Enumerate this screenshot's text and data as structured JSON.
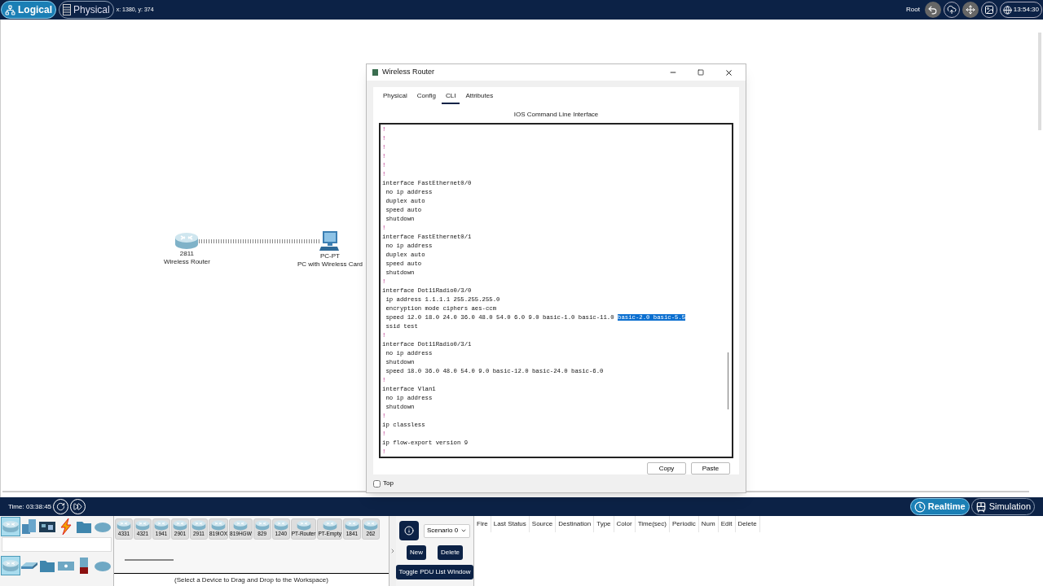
{
  "top_bar": {
    "modes": [
      {
        "label": "Logical",
        "kind": "logical",
        "selected": true
      },
      {
        "label": "Physical",
        "kind": "physical",
        "selected": false
      }
    ],
    "coords": "x: 1380, y: 374",
    "user": "Root",
    "clock": "13:54:30"
  },
  "workspace": {
    "nodes": [
      {
        "kind": "router",
        "model": "2811",
        "name": "Wireless Router"
      },
      {
        "kind": "pc",
        "model": "PC-PT",
        "name": "PC with Wireless Card"
      }
    ]
  },
  "dialog": {
    "title": "Wireless Router",
    "tabs": [
      {
        "label": "Physical",
        "selected": false
      },
      {
        "label": "Config",
        "selected": false
      },
      {
        "label": "CLI",
        "selected": true
      },
      {
        "label": "Attributes",
        "selected": false
      }
    ],
    "heading": "IOS Command Line Interface",
    "cli": [
      {
        "text": "!"
      },
      {
        "text": "!"
      },
      {
        "text": "!"
      },
      {
        "text": "!"
      },
      {
        "text": "!"
      },
      {
        "text": "!"
      },
      {
        "text": "interface FastEthernet0/0"
      },
      {
        "text": " no ip address"
      },
      {
        "text": " duplex auto"
      },
      {
        "text": " speed auto"
      },
      {
        "text": " shutdown"
      },
      {
        "text": "!"
      },
      {
        "text": "interface FastEthernet0/1"
      },
      {
        "text": " no ip address"
      },
      {
        "text": " duplex auto"
      },
      {
        "text": " speed auto"
      },
      {
        "text": " shutdown"
      },
      {
        "text": "!"
      },
      {
        "text": "interface Dot11Radio0/3/0"
      },
      {
        "text": " ip address 1.1.1.1 255.255.255.0"
      },
      {
        "text": " encryption mode ciphers aes-ccm"
      },
      {
        "text": " speed 12.0 18.0 24.0 36.0 48.0 54.0 6.0 9.0 basic-1.0 basic-11.0 ",
        "highlight": "basic-2.0 basic-5.5"
      },
      {
        "text": " ssid test"
      },
      {
        "text": "!"
      },
      {
        "text": "interface Dot11Radio0/3/1"
      },
      {
        "text": " no ip address"
      },
      {
        "text": " shutdown"
      },
      {
        "text": " speed 18.0 36.0 48.0 54.0 9.0 basic-12.0 basic-24.0 basic-6.0"
      },
      {
        "text": "!"
      },
      {
        "text": "interface Vlan1"
      },
      {
        "text": " no ip address"
      },
      {
        "text": " shutdown"
      },
      {
        "text": "!"
      },
      {
        "text": "ip classless"
      },
      {
        "text": "!"
      },
      {
        "text": "ip flow-export version 9"
      },
      {
        "text": "!"
      }
    ],
    "buttons": [
      "Copy",
      "Paste"
    ],
    "top": {
      "label": "Top",
      "checked": false
    }
  },
  "bottom_bar": {
    "time": "Time: 03:38:45",
    "modes": [
      {
        "label": "Realtime",
        "kind": "realtime",
        "selected": true
      },
      {
        "label": "Simulation",
        "kind": "simulation",
        "selected": false
      }
    ]
  },
  "device_panel": {
    "categories": [
      {
        "kind": "network",
        "selected": true
      },
      {
        "kind": "end",
        "selected": false
      },
      {
        "kind": "component",
        "selected": false
      },
      {
        "kind": "connection",
        "selected": false
      },
      {
        "kind": "folder",
        "selected": false
      },
      {
        "kind": "cloud",
        "selected": false
      }
    ],
    "subcategories": [
      {
        "kind": "router",
        "selected": true
      },
      {
        "kind": "switch",
        "selected": false
      },
      {
        "kind": "hub",
        "selected": false
      },
      {
        "kind": "wireless",
        "selected": false
      },
      {
        "kind": "security",
        "selected": false
      },
      {
        "kind": "wan",
        "selected": false
      }
    ],
    "devices": [
      "4331",
      "4321",
      "1941",
      "2901",
      "2911",
      "819IOX",
      "819HGW",
      "829",
      "1240",
      "PT-Router",
      "PT-Empty",
      "1841",
      "262"
    ],
    "hint": "(Select a Device to Drag and Drop to the Workspace)"
  },
  "scenario": {
    "value": "Scenario 0",
    "buttons": [
      "New",
      "Delete"
    ],
    "toggle": "Toggle PDU List Window"
  },
  "pdu_table": {
    "columns": [
      "Fire",
      "Last Status",
      "Source",
      "Destination",
      "Type",
      "Color",
      "Time(sec)",
      "Periodic",
      "Num",
      "Edit",
      "Delete"
    ]
  }
}
